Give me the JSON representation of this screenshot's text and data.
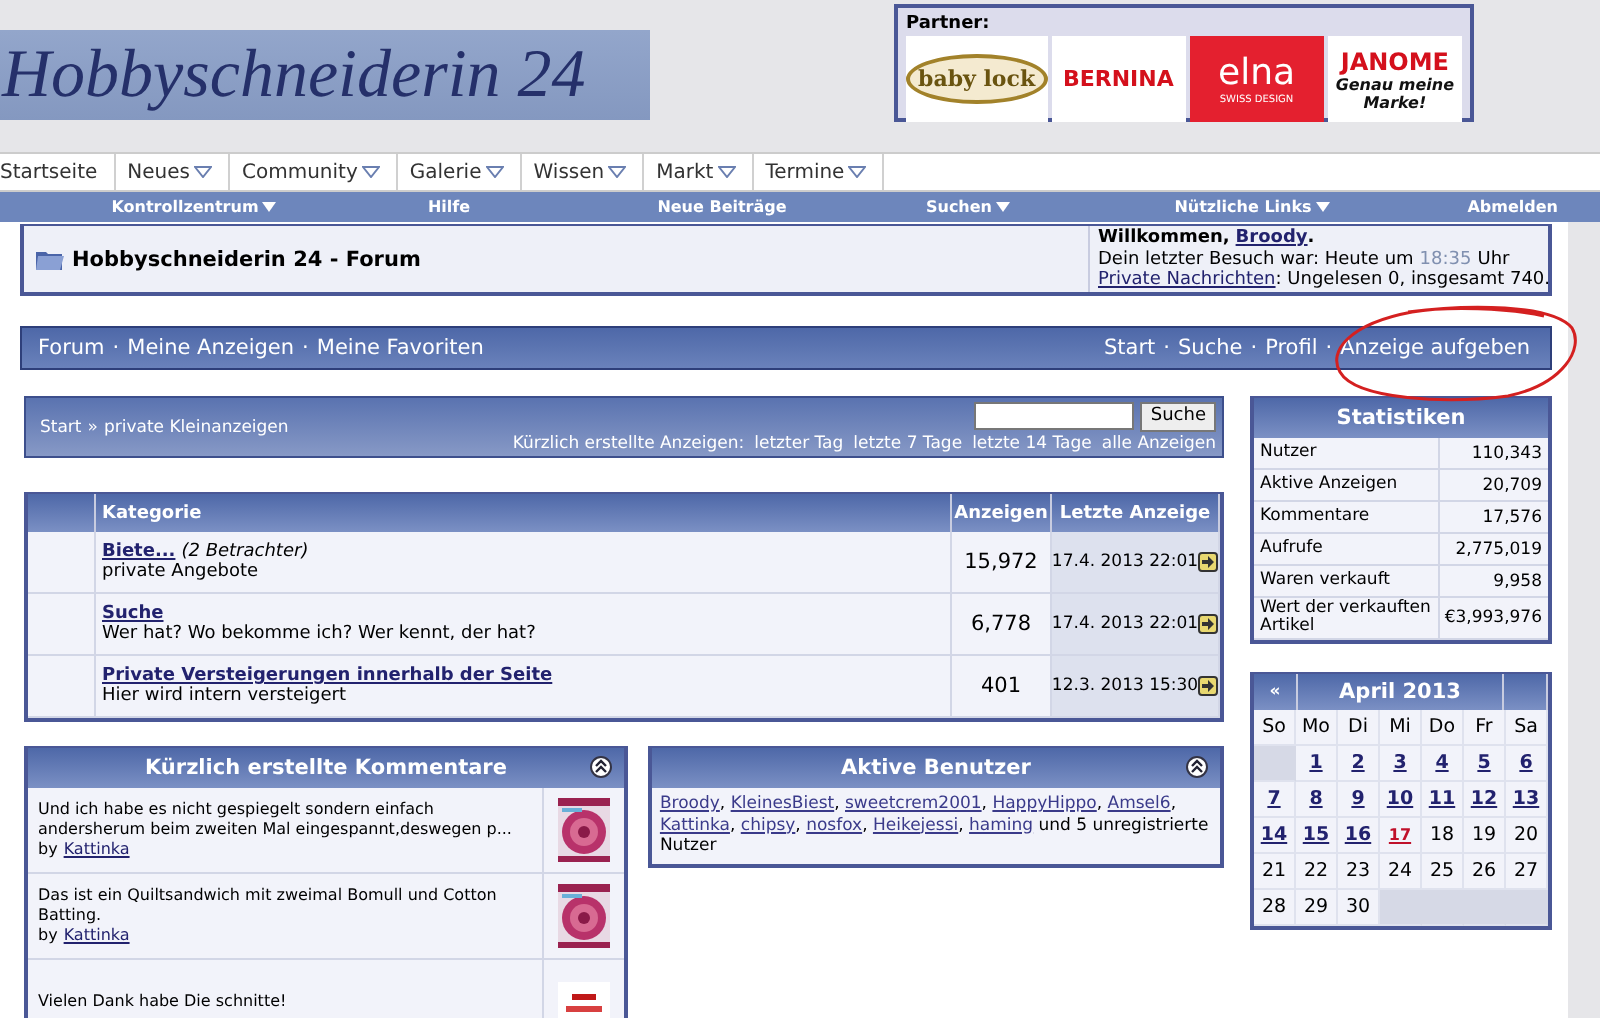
{
  "logo": {
    "text": "Hobbyschneiderin 24"
  },
  "partners": {
    "label": "Partner:",
    "logos": [
      {
        "kind": "babylock",
        "text": "baby lock"
      },
      {
        "kind": "bernina",
        "text": "BERNINA"
      },
      {
        "kind": "elna",
        "text": "elna",
        "sub": "SWISS DESIGN"
      },
      {
        "kind": "janome",
        "text": "JANOME",
        "sub": "Genau meine Marke!"
      }
    ]
  },
  "nav_tabs": [
    {
      "label": "Startseite",
      "dropdown": false
    },
    {
      "label": "Neues",
      "dropdown": true
    },
    {
      "label": "Community",
      "dropdown": true
    },
    {
      "label": "Galerie",
      "dropdown": true
    },
    {
      "label": "Wissen",
      "dropdown": true
    },
    {
      "label": "Markt",
      "dropdown": true
    },
    {
      "label": "Termine",
      "dropdown": true
    }
  ],
  "menu_bar": [
    {
      "label": "Kontrollzentrum",
      "dropdown": true
    },
    {
      "label": "Hilfe",
      "dropdown": false
    },
    {
      "label": "Neue Beiträge",
      "dropdown": false
    },
    {
      "label": "Suchen",
      "dropdown": true
    },
    {
      "label": "Nützliche Links",
      "dropdown": true
    },
    {
      "label": "Abmelden",
      "dropdown": false
    }
  ],
  "forum_header": {
    "title": "Hobbyschneiderin 24 - Forum",
    "welcome": "Willkommen,",
    "user": "Broody",
    "welcome_end": ".",
    "last_visit": "Dein letzter Besuch war: Heute um",
    "last_visit_time": "18:35",
    "last_visit_end": "Uhr",
    "messages_link": "Private Nachrichten",
    "messages_text": ": Ungelesen 0, insgesamt 740."
  },
  "nav_bar": {
    "separator": "·",
    "left": [
      "Forum",
      "Meine Anzeigen",
      "Meine Favoriten"
    ],
    "right": [
      "Start",
      "Suche",
      "Profil",
      "Anzeige aufgeben"
    ]
  },
  "breadcrumb": {
    "items": [
      "Start",
      "private Kleinanzeigen"
    ],
    "separator": "»",
    "search_button": "Suche",
    "recent_label": "Kürzlich erstellte Anzeigen:",
    "recent_links": [
      "letzter Tag",
      "letzte 7 Tage",
      "letzte 14 Tage",
      "alle Anzeigen"
    ]
  },
  "category_table": {
    "columns": [
      "Kategorie",
      "Anzeigen",
      "Letzte Anzeige"
    ],
    "rows": [
      {
        "title": "Biete...",
        "viewers": "(2 Betrachter)",
        "description": "private Angebote",
        "count": "15,972",
        "last": "17.4. 2013 22:01"
      },
      {
        "title": "Suche",
        "description": "Wer hat? Wo bekomme ich? Wer kennt, der hat?",
        "count": "6,778",
        "last": "17.4. 2013 22:01"
      },
      {
        "title": "Private Versteigerungen innerhalb der Seite",
        "description": "Hier wird intern versteigert",
        "count": "401",
        "last": "12.3. 2013 15:30"
      }
    ]
  },
  "statistics": {
    "title": "Statistiken",
    "rows": [
      {
        "label": "Nutzer",
        "value": "110,343"
      },
      {
        "label": "Aktive Anzeigen",
        "value": "20,709"
      },
      {
        "label": "Kommentare",
        "value": "17,576"
      },
      {
        "label": "Aufrufe",
        "value": "2,775,019"
      },
      {
        "label": "Waren verkauft",
        "value": "9,958"
      },
      {
        "label": "Wert der verkauften Artikel",
        "value": "€3,993,976"
      }
    ]
  },
  "calendar": {
    "prev": "«",
    "title": "April 2013",
    "weekdays": [
      "So",
      "Mo",
      "Di",
      "Mi",
      "Do",
      "Fr",
      "Sa"
    ],
    "weeks": [
      [
        {
          "kind": "empty"
        },
        {
          "day": "1",
          "kind": "link"
        },
        {
          "day": "2",
          "kind": "link"
        },
        {
          "day": "3",
          "kind": "link"
        },
        {
          "day": "4",
          "kind": "link"
        },
        {
          "day": "5",
          "kind": "link"
        },
        {
          "day": "6",
          "kind": "link"
        }
      ],
      [
        {
          "day": "7",
          "kind": "link"
        },
        {
          "day": "8",
          "kind": "link"
        },
        {
          "day": "9",
          "kind": "link"
        },
        {
          "day": "10",
          "kind": "link"
        },
        {
          "day": "11",
          "kind": "link"
        },
        {
          "day": "12",
          "kind": "link"
        },
        {
          "day": "13",
          "kind": "link"
        }
      ],
      [
        {
          "day": "14",
          "kind": "link"
        },
        {
          "day": "15",
          "kind": "link"
        },
        {
          "day": "16",
          "kind": "link"
        },
        {
          "day": "17",
          "kind": "today"
        },
        {
          "day": "18",
          "kind": "plain"
        },
        {
          "day": "19",
          "kind": "plain"
        },
        {
          "day": "20",
          "kind": "plain"
        }
      ],
      [
        {
          "day": "21",
          "kind": "plain"
        },
        {
          "day": "22",
          "kind": "plain"
        },
        {
          "day": "23",
          "kind": "plain"
        },
        {
          "day": "24",
          "kind": "plain"
        },
        {
          "day": "25",
          "kind": "plain"
        },
        {
          "day": "26",
          "kind": "plain"
        },
        {
          "day": "27",
          "kind": "plain"
        }
      ],
      [
        {
          "day": "28",
          "kind": "plain"
        },
        {
          "day": "29",
          "kind": "plain"
        },
        {
          "day": "30",
          "kind": "plain"
        },
        {
          "kind": "empty"
        },
        {
          "kind": "empty"
        },
        {
          "kind": "empty"
        },
        {
          "kind": "empty"
        }
      ]
    ]
  },
  "comments": {
    "title": "Kürzlich erstellte Kommentare",
    "items": [
      {
        "text": "Und ich habe es nicht gespiegelt sondern einfach andersherum beim zweiten Mal eingespannt,deswegen p...",
        "by": "by",
        "author": "Kattinka"
      },
      {
        "text": "Das ist ein Quiltsandwich mit zweimal Bomull und Cotton Batting.",
        "by": "by",
        "author": "Kattinka"
      },
      {
        "text": "Vielen Dank habe Die schnitte!"
      }
    ]
  },
  "active_users": {
    "title": "Aktive Benutzer",
    "users": [
      "Broody",
      "KleinesBiest",
      "sweetcrem2001",
      "HappyHippo",
      "Amsel6",
      "Kattinka",
      "chipsy",
      "nosfox",
      "Heikejessi",
      "haming"
    ],
    "separator": ",",
    "tail": "und 5 unregistrierte Nutzer"
  }
}
